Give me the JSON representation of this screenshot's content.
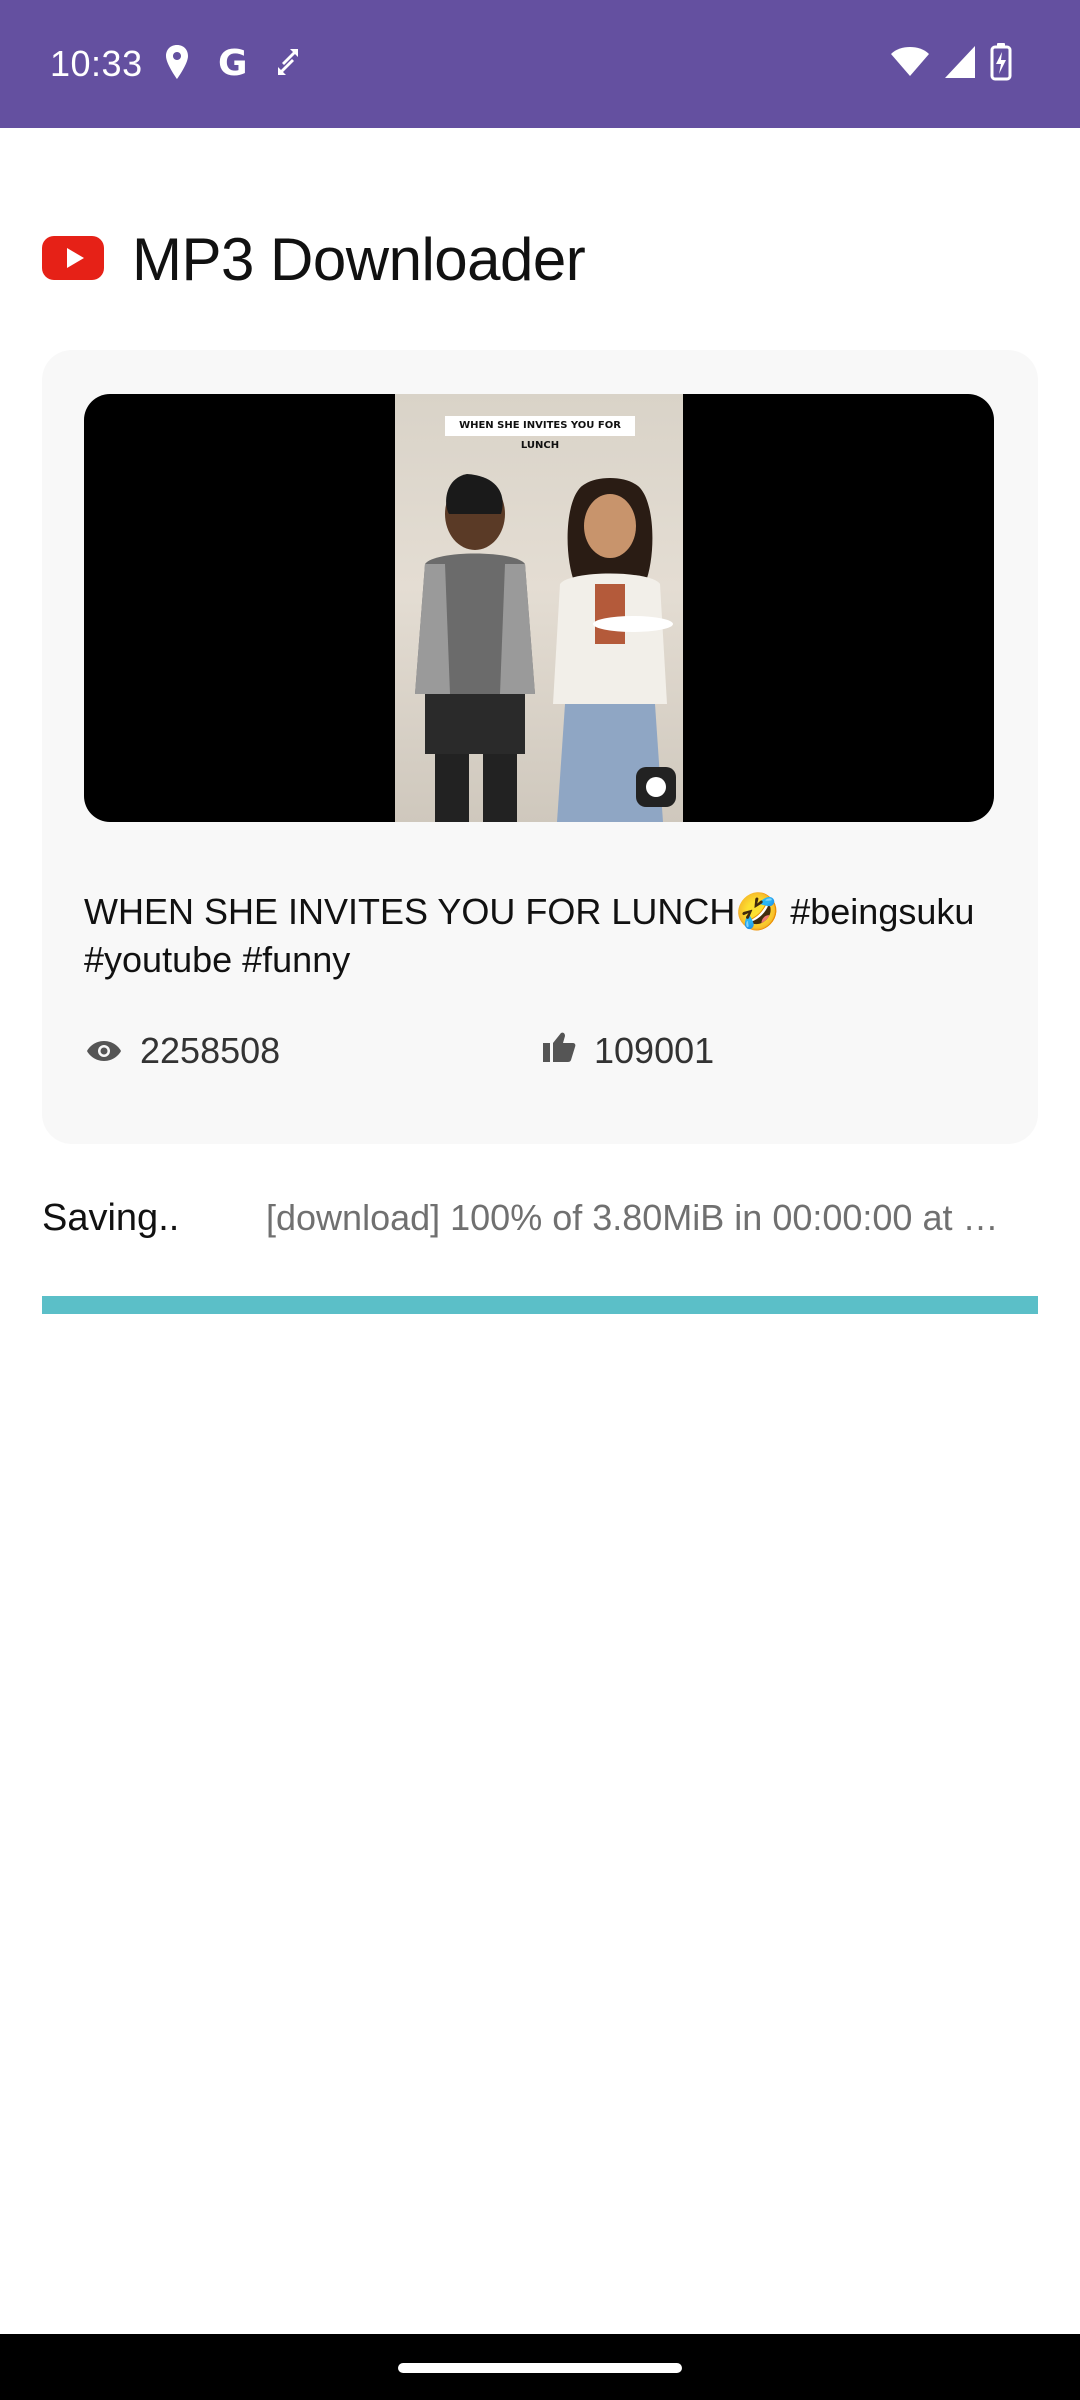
{
  "status_bar": {
    "time": "10:33",
    "left_icons": [
      "location-pin-icon",
      "google-icon",
      "sync-icon"
    ],
    "google_letter": "G",
    "right_icons": [
      "wifi-icon",
      "signal-icon",
      "battery-charging-icon"
    ],
    "background_color": "#6450a0"
  },
  "header": {
    "logo_icon": "youtube-logo-icon",
    "logo_color": "#e62117",
    "title": "MP3 Downloader"
  },
  "video": {
    "thumbnail_caption": "WHEN SHE INVITES YOU FOR LUNCH",
    "title": "WHEN SHE INVITES YOU FOR LUNCH🤣 #beingsuku #youtube #funny",
    "views": "2258508",
    "views_icon": "eye-icon",
    "likes": "109001",
    "likes_icon": "thumbs-up-icon"
  },
  "download": {
    "status_label": "Saving..",
    "progress_text": "[download] 100% of    3.80MiB in 00:00:00 at …",
    "progress_fraction": 1.0,
    "progress_color": "#5bbfc8"
  }
}
